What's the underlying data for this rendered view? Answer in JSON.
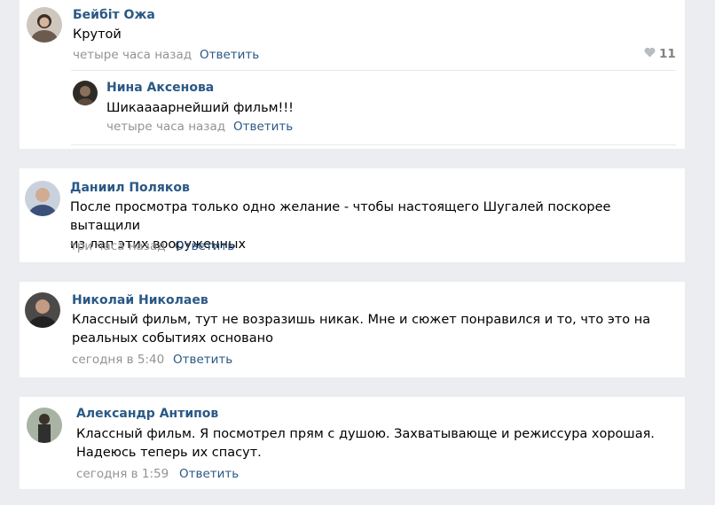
{
  "comments": [
    {
      "author": "Бейбіт Ожа",
      "text": "Крутой",
      "time": "четыре часа назад",
      "reply_label": "Ответить",
      "likes": "11",
      "replies": [
        {
          "author": "Нина Аксенова",
          "text": "Шикаааарнейший фильм!!!",
          "time": "четыре часа назад",
          "reply_label": "Ответить"
        }
      ]
    },
    {
      "author": "Даниил Поляков",
      "text_lines": [
        "После просмотра только одно желание - чтобы настоящего Шугалей поскорее вытащили",
        "из лап этих вооруженных"
      ],
      "time": "три часа назад",
      "reply_label": "Ответить"
    },
    {
      "author": "Николай Николаев",
      "text_lines": [
        "Классный фильм, тут не возразишь никак. Мне и сюжет понравился и то, что это на",
        "реальных событиях основано"
      ],
      "time": "сегодня в 5:40",
      "reply_label": "Ответить"
    },
    {
      "author": "Александр Антипов",
      "text_lines": [
        "Классный фильм. Я посмотрел прям с душою. Захватывающе и режиссура хорошая.",
        "Надеюсь теперь их спасут."
      ],
      "time": "сегодня в 1:59",
      "reply_label": "Ответить"
    }
  ],
  "icons": {
    "like": "heart-icon"
  },
  "colors": {
    "link": "#2a5885",
    "meta": "#939393",
    "background": "#ebedf0"
  }
}
